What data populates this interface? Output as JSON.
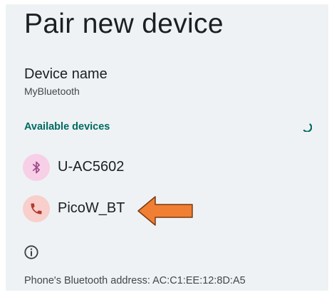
{
  "header": {
    "title": "Pair new device"
  },
  "device_name": {
    "label": "Device name",
    "value": "MyBluetooth"
  },
  "available_devices": {
    "header": "Available devices",
    "items": [
      {
        "label": "U-AC5602",
        "icon": "bluetooth-icon",
        "icon_bg": "#f7cfe6",
        "icon_color": "#9c4a8a"
      },
      {
        "label": "PicoW_BT",
        "icon": "phone-icon",
        "icon_bg": "#f8cfcb",
        "icon_color": "#b23a33"
      }
    ]
  },
  "footer": {
    "info_icon": "info-icon",
    "address_text": "Phone's Bluetooth address: AC:C1:EE:12:8D:A5"
  },
  "colors": {
    "background": "#eef2f4",
    "accent": "#006a60",
    "annotation_arrow_fill": "#f07f33",
    "annotation_arrow_stroke": "#7a3a12"
  }
}
